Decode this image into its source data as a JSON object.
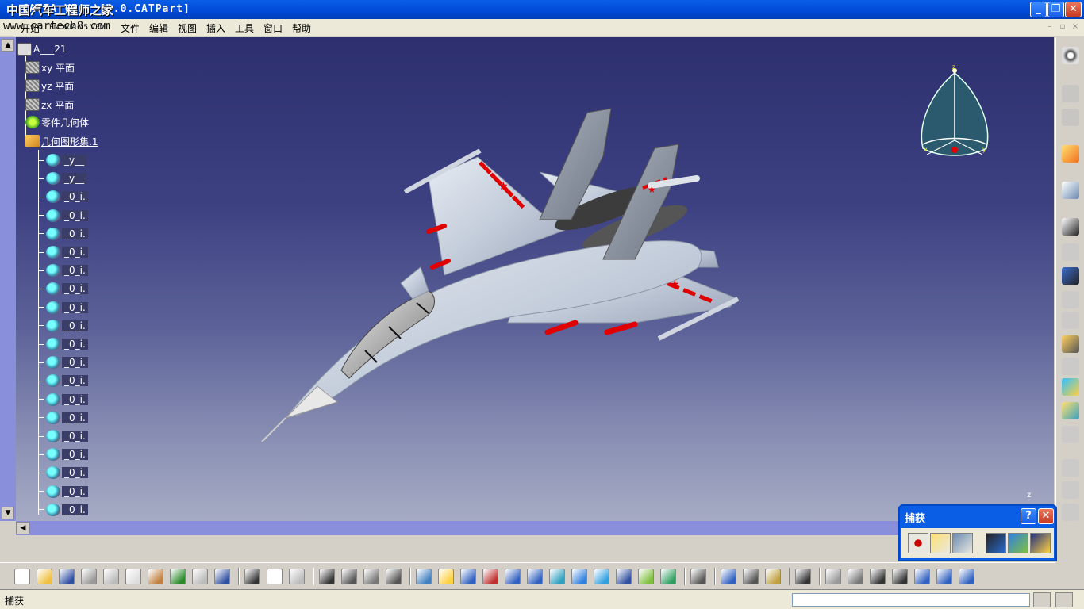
{
  "window": {
    "title": "CATIA V5 - [0.0.CATPart]",
    "watermark": "中国汽车工程师之家",
    "watermark_url": "www.cartech8.com",
    "minimize": "_",
    "restore": "❐",
    "close": "✕"
  },
  "menu": {
    "items": [
      "开始",
      "ENOVIA V5 VPM",
      "文件",
      "编辑",
      "视图",
      "插入",
      "工具",
      "窗口",
      "帮助"
    ]
  },
  "tree": {
    "root": "A___21",
    "nodes": [
      {
        "label": "xy 平面",
        "icon": "plane-icon"
      },
      {
        "label": "yz 平面",
        "icon": "plane-icon"
      },
      {
        "label": "zx 平面",
        "icon": "plane-icon"
      },
      {
        "label": "零件几何体",
        "icon": "body-icon"
      },
      {
        "label": "几何图形集.1",
        "icon": "geometric-set-icon"
      }
    ],
    "children": [
      "_y__",
      "_y__",
      "_0_i.",
      "_0_i.",
      "_0_i.",
      "_0_i.",
      "_0_i.",
      "_0_i.",
      "_0_i.",
      "_0_i.",
      "_0_i.",
      "_0_i.",
      "_0_i.",
      "_0_i.",
      "_0_i.",
      "_0_i.",
      "_0_i.",
      "_0_i.",
      "_0_i.",
      "_0_i."
    ]
  },
  "compass": {
    "x": "x",
    "y": "y",
    "z": "z"
  },
  "axis_label": "z",
  "capture": {
    "title": "捕获",
    "help": "?",
    "close": "✕"
  },
  "status": {
    "text": "捕获",
    "input_value": ""
  },
  "colors": {
    "titlebar": "#0a5ee6",
    "viewport_top": "#2d2f6e",
    "viewport_bottom": "#a6abc4",
    "aircraft": "#c9d2df",
    "accent_red": "#e00000"
  }
}
